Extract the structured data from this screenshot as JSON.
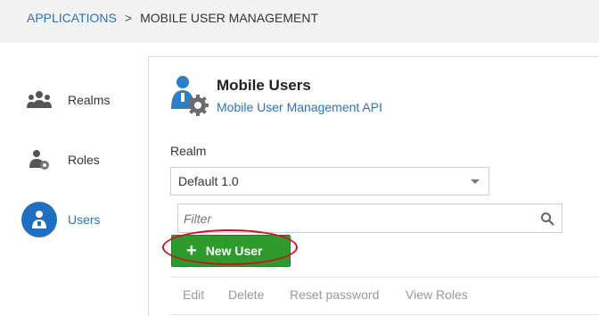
{
  "breadcrumb": {
    "root": "APPLICATIONS",
    "separator": ">",
    "current": "MOBILE USER MANAGEMENT"
  },
  "sidebar": {
    "items": [
      {
        "label": "Realms",
        "icon": "realms-icon"
      },
      {
        "label": "Roles",
        "icon": "roles-icon"
      },
      {
        "label": "Users",
        "icon": "users-icon",
        "active": true
      }
    ]
  },
  "header": {
    "title": "Mobile Users",
    "subtitle": "Mobile User Management API"
  },
  "realm": {
    "label": "Realm",
    "selected": "Default 1.0"
  },
  "filter": {
    "placeholder": "Filter"
  },
  "toolbar": {
    "new_user_label": "New User"
  },
  "actions": [
    "Edit",
    "Delete",
    "Reset password",
    "View Roles"
  ],
  "colors": {
    "accent": "#2d72b7",
    "button_green": "#2e9a2e",
    "highlight_red": "#c8151b",
    "active_circle": "#1f6fc1"
  }
}
